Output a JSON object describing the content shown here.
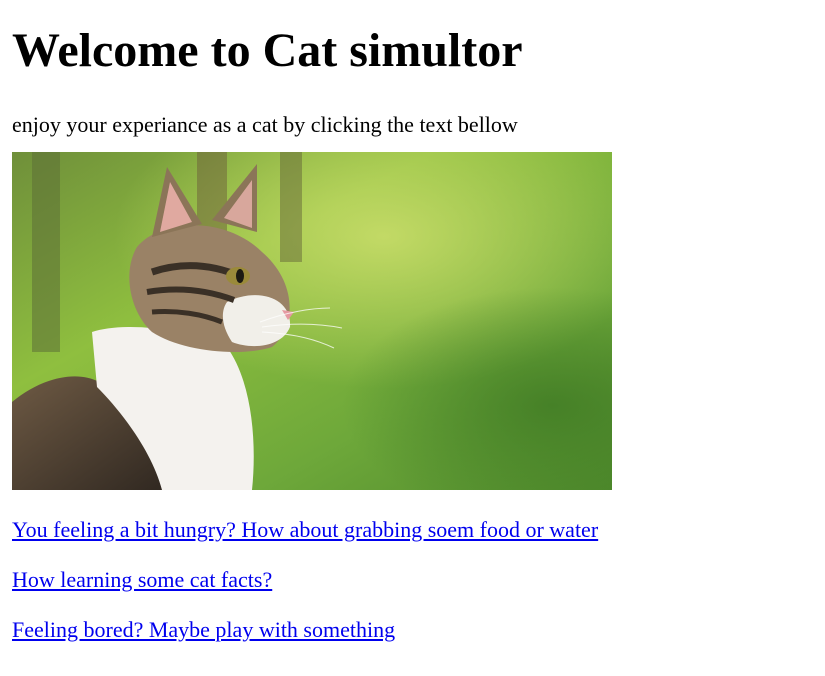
{
  "page": {
    "title": "Welcome to Cat simultor",
    "intro": "enjoy your experiance as a cat by clicking the text bellow"
  },
  "photo": {
    "subject": "cat-photo"
  },
  "links": [
    {
      "label": "You feeling a bit hungry? How about grabbing soem food or water"
    },
    {
      "label": "How learning some cat facts?"
    },
    {
      "label": "Feeling bored? Maybe play with something"
    }
  ],
  "colors": {
    "link": "#0000ee",
    "text": "#000000",
    "background": "#ffffff"
  }
}
